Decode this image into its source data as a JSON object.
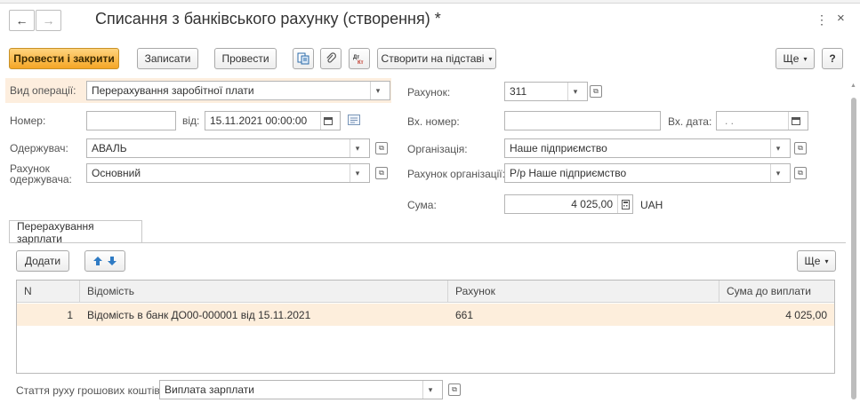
{
  "window": {
    "title": "Списання з банківського рахунку (створення) *",
    "more_glyph": "⋮",
    "close_glyph": "×",
    "back_glyph": "←",
    "forward_glyph": "→"
  },
  "toolbar": {
    "post_close": "Провести і закрити",
    "save": "Записати",
    "post": "Провести",
    "create_based": "Створити на підставі",
    "more": "Ще",
    "help": "?"
  },
  "form": {
    "operation_label": "Вид операції:",
    "operation_value": "Перерахування заробітної плати",
    "number_label": "Номер:",
    "number_value": "",
    "date_label": "від:",
    "date_value": "15.11.2021 00:00:00",
    "recipient_label": "Одержувач:",
    "recipient_value": "АВАЛЬ",
    "recipient_account_label_1": "Рахунок",
    "recipient_account_label_2": "одержувача:",
    "recipient_account_value": "Основний",
    "account_label": "Рахунок:",
    "account_value": "311",
    "in_number_label": "Вх. номер:",
    "in_number_value": "",
    "in_date_label": "Вх. дата:",
    "in_date_value": ". .",
    "org_label": "Організація:",
    "org_value": "Наше підприємство",
    "org_account_label": "Рахунок організації:",
    "org_account_value": "Р/р Наше підприємство",
    "sum_label": "Сума:",
    "sum_value": "4 025,00",
    "currency": "UAH"
  },
  "tab": {
    "label": "Перерахування зарплати",
    "add": "Додати",
    "more": "Ще"
  },
  "table": {
    "columns": [
      "N",
      "Відомість",
      "Рахунок",
      "Сума до виплати"
    ],
    "rows": [
      {
        "n": "1",
        "statement": "Відомість в банк ДО00-000001 від 15.11.2021",
        "account": "661",
        "sum": "4 025,00"
      }
    ]
  },
  "footer": {
    "cashflow_label": "Стаття руху грошових коштів:",
    "cashflow_value": "Виплата зарплати"
  },
  "colors": {
    "accent": "#f5a626",
    "highlight": "#fdeedc"
  }
}
